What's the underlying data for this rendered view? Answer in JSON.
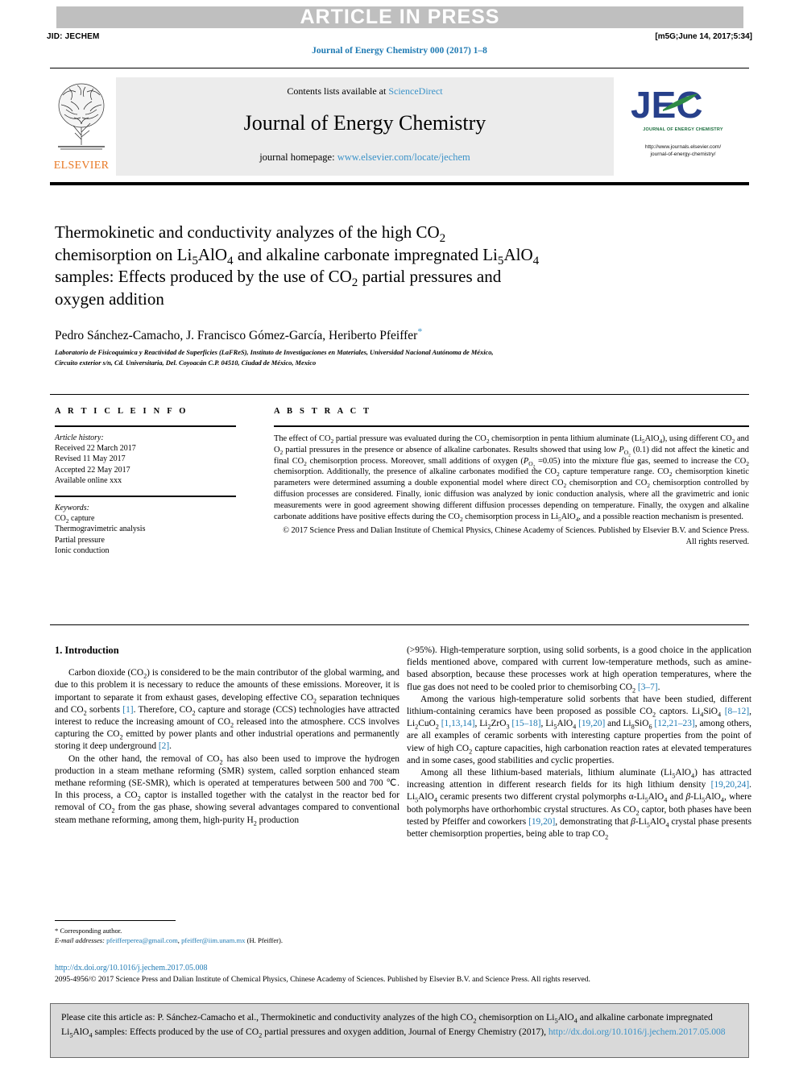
{
  "banner": {
    "text": "ARTICLE IN PRESS",
    "jid": "JID: JECHEM",
    "build_tag": "[m5G;June 14, 2017;5:34]",
    "running_head": "Journal of Energy Chemistry 000 (2017) 1–8"
  },
  "masthead": {
    "publisher_logo_word": "ELSEVIER",
    "contents_prefix": "Contents lists available at ",
    "contents_link": "ScienceDirect",
    "journal_name": "Journal of Energy Chemistry",
    "homepage_prefix": "journal homepage: ",
    "homepage_url": "www.elsevier.com/locate/jechem",
    "jec_logo_text": "JEC",
    "jec_logo_sub": "JOURNAL OF ENERGY CHEMISTRY",
    "jec_url_line1": "http://www.journals.elsevier.com/",
    "jec_url_line2": "journal-of-energy-chemistry/"
  },
  "article": {
    "title_line1": "Thermokinetic and conductivity analyzes of the high CO",
    "title_line1_sub": "2",
    "title_line2_a": "chemisorption on Li",
    "title_line2_sub1": "5",
    "title_line2_b": "AlO",
    "title_line2_sub2": "4",
    "title_line2_c": " and alkaline carbonate impregnated Li",
    "title_line2_sub3": "5",
    "title_line2_d": "AlO",
    "title_line2_sub4": "4",
    "title_line3": "samples: Effects produced by the use of CO",
    "title_line3_sub": "2",
    "title_line3_b": " partial pressures and",
    "title_line4": "oxygen addition",
    "authors": "Pedro Sánchez-Camacho, J. Francisco Gómez-García, Heriberto Pfeiffer",
    "corresponding_marker": "*",
    "affiliation_line1": "Laboratorio de Fisicoquímica y Reactividad de Superficies (LaFReS), Instituto de Investigaciones en Materiales, Universidad Nacional Autónoma de México,",
    "affiliation_line2": "Circuito exterior s/n, Cd. Universitaria, Del. Coyoacán C.P. 04510, Ciudad de México, Mexico"
  },
  "article_info": {
    "heading": "A R T I C L E    I N F O",
    "history_label": "Article history:",
    "history": [
      "Received 22 March 2017",
      "Revised 11 May 2017",
      "Accepted 22 May 2017",
      "Available online xxx"
    ],
    "keywords_label": "Keywords:",
    "keywords": [
      "CO2 capture",
      "Thermogravimetric analysis",
      "Partial pressure",
      "Ionic conduction"
    ]
  },
  "abstract": {
    "heading": "A B S T R A C T",
    "body": "The effect of CO2 partial pressure was evaluated during the CO2 chemisorption in penta lithium aluminate (Li5AlO4), using different CO2 and O2 partial pressures in the presence or absence of alkaline carbonates. Results showed that using low PO2 (0.1) did not affect the kinetic and final CO2 chemisorption process. Moreover, small additions of oxygen (PO2 =0.05) into the mixture flue gas, seemed to increase the CO2 chemisorption. Additionally, the presence of alkaline carbonates modified the CO2 capture temperature range. CO2 chemisorption kinetic parameters were determined assuming a double exponential model where direct CO2 chemisorption and CO2 chemisorption controlled by diffusion processes are considered. Finally, ionic diffusion was analyzed by ionic conduction analysis, where all the gravimetric and ionic measurements were in good agreement showing different diffusion processes depending on temperature. Finally, the oxygen and alkaline carbonate additions have positive effects during the CO2 chemisorption process in Li5AlO4, and a possible reaction mechanism is presented.",
    "copyright": "© 2017 Science Press and Dalian Institute of Chemical Physics, Chinese Academy of Sciences. Published by Elsevier B.V. and Science Press. All rights reserved."
  },
  "introduction": {
    "heading": "1. Introduction",
    "left_paragraphs": [
      "Carbon dioxide (CO2) is considered to be the main contributor of the global warming, and due to this problem it is necessary to reduce the amounts of these emissions. Moreover, it is important to separate it from exhaust gases, developing effective CO2 separation techniques and CO2 sorbents [1]. Therefore, CO2 capture and storage (CCS) technologies have attracted interest to reduce the increasing amount of CO2 released into the atmosphere. CCS involves capturing the CO2 emitted by power plants and other industrial operations and permanently storing it deep underground [2].",
      "On the other hand, the removal of CO2 has also been used to improve the hydrogen production in a steam methane reforming (SMR) system, called sorption enhanced steam methane reforming (SE-SMR), which is operated at temperatures between 500 and 700 °C. In this process, a CO2 captor is installed together with the catalyst in the reactor bed for removal of CO2 from the gas phase, showing several advantages compared to conventional steam methane reforming, among them, high-purity H2 production"
    ],
    "right_paragraphs": [
      "(>95%). High-temperature sorption, using solid sorbents, is a good choice in the application fields mentioned above, compared with current low-temperature methods, such as amine-based absorption, because these processes work at high operation temperatures, where the flue gas does not need to be cooled prior to chemisorbing CO2 [3–7].",
      "Among the various high-temperature solid sorbents that have been studied, different lithium-containing ceramics have been proposed as possible CO2 captors. Li4SiO4 [8–12], Li2CuO2 [1,13,14], Li2ZrO3 [15–18], Li5AlO4 [19,20] and Li8SiO6 [12,21–23], among others, are all examples of ceramic sorbents with interesting capture properties from the point of view of high CO2 capture capacities, high carbonation reaction rates at elevated temperatures and in some cases, good stabilities and cyclic properties.",
      "Among all these lithium-based materials, lithium aluminate (Li5AlO4) has attracted increasing attention in different research fields for its high lithium density [19,20,24]. Li5AlO4 ceramic presents two different crystal polymorphs α-Li5AlO4 and β-Li5AlO4, where both polymorphs have orthorhombic crystal structures. As CO2 captor, both phases have been tested by Pfeiffer and coworkers [19,20], demonstrating that β-Li5AlO4 crystal phase presents better chemisorption properties, being able to trap CO2"
    ]
  },
  "footnote": {
    "corresponding": "* Corresponding author.",
    "email_label": "E-mail addresses:",
    "email1": "pfeifferperea@gmail.com",
    "email2": "pfeiffer@iim.unam.mx",
    "email_suffix": "(H. Pfeiffer).",
    "doi": "http://dx.doi.org/10.1016/j.jechem.2017.05.008",
    "copyright_line": "2095-4956/© 2017 Science Press and Dalian Institute of Chemical Physics, Chinese Academy of Sciences. Published by Elsevier B.V. and Science Press. All rights reserved."
  },
  "cite_box": {
    "prefix": "Please cite this article as: P. Sánchez-Camacho et al., Thermokinetic and conductivity analyzes of the high CO",
    "sub1": "2",
    "mid1": " chemisorption on Li",
    "sub2": "5",
    "mid2": "AlO",
    "sub3": "4",
    "mid3": " and alkaline carbonate impregnated Li",
    "sub4": "5",
    "mid4": "AlO",
    "sub5": "4",
    "mid5": " samples: Effects produced by the use of CO",
    "sub6": "2",
    "mid6": " partial pressures and oxygen addition, Journal of Energy Chemistry (2017), ",
    "url": "http://dx.doi.org/10.1016/j.jechem.2017.05.008"
  },
  "colors": {
    "link": "#3a92c8",
    "reference": "#1f7ab3",
    "banner_bg": "#bfbfbf",
    "masthead_bg": "#ececec",
    "cite_bg": "#d9d9d9",
    "elsevier_orange": "#E87722",
    "jec_blue": "#27408B",
    "jec_green": "#1d6f3f"
  }
}
